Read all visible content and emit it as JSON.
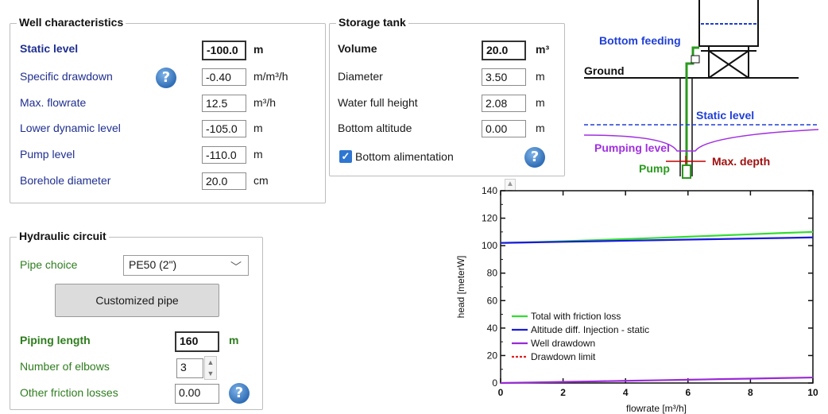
{
  "well": {
    "title": "Well characteristics",
    "static_level": {
      "label": "Static level",
      "value": "-100.0",
      "unit": "m"
    },
    "specific_drawdown": {
      "label": "Specific drawdown",
      "value": "-0.40",
      "unit": "m/m³/h"
    },
    "max_flowrate": {
      "label": "Max. flowrate",
      "value": "12.5",
      "unit": "m³/h"
    },
    "lower_dynamic_level": {
      "label": "Lower dynamic level",
      "value": "-105.0",
      "unit": "m"
    },
    "pump_level": {
      "label": "Pump level",
      "value": "-110.0",
      "unit": "m"
    },
    "borehole_diameter": {
      "label": "Borehole diameter",
      "value": "20.0",
      "unit": "cm"
    },
    "help_icon": "question-icon"
  },
  "tank": {
    "title": "Storage tank",
    "volume": {
      "label": "Volume",
      "value": "20.0",
      "unit": "m³"
    },
    "diameter": {
      "label": "Diameter",
      "value": "3.50",
      "unit": "m"
    },
    "water_full_height": {
      "label": "Water full height",
      "value": "2.08",
      "unit": "m"
    },
    "bottom_altitude": {
      "label": "Bottom altitude",
      "value": "0.00",
      "unit": "m"
    },
    "bottom_alimentation": {
      "label": "Bottom alimentation",
      "checked": true
    },
    "help_icon": "question-icon"
  },
  "hydraulic": {
    "title": "Hydraulic circuit",
    "pipe_choice": {
      "label": "Pipe choice",
      "value": "PE50 (2\")"
    },
    "customized_pipe_label": "Customized pipe",
    "piping_length": {
      "label": "Piping length",
      "value": "160",
      "unit": "m"
    },
    "number_of_elbows": {
      "label": "Number of elbows",
      "value": "3"
    },
    "other_friction_losses": {
      "label": "Other friction losses",
      "value": "0.00"
    },
    "help_icon": "question-icon"
  },
  "diagram": {
    "bottom_feeding": "Bottom feeding",
    "ground": "Ground",
    "static_level": "Static level",
    "pumping_level": "Pumping level",
    "pump": "Pump",
    "max_depth": "Max. depth",
    "colors": {
      "blue": "#1f3fd6",
      "purple": "#a030e0",
      "green": "#2a9a1e",
      "red": "#c00000"
    }
  },
  "chart_data": {
    "type": "line",
    "xlabel": "flowrate [m³/h]",
    "ylabel": "head [meterW]",
    "xlim": [
      0,
      10
    ],
    "ylim": [
      0,
      140
    ],
    "xticks": [
      "0",
      "2",
      "4",
      "6",
      "8",
      "10"
    ],
    "yticks": [
      "0",
      "20",
      "40",
      "60",
      "80",
      "100",
      "120",
      "140"
    ],
    "series": [
      {
        "name": "Total with friction loss",
        "color": "#33dd33",
        "x": [
          0,
          1,
          2,
          3,
          4,
          5,
          6,
          7,
          8,
          9,
          10
        ],
        "y": [
          102,
          102.5,
          103.2,
          104,
          104.8,
          105.6,
          106.5,
          107.4,
          108.3,
          109.2,
          110
        ]
      },
      {
        "name": "Altitude diff. Injection - static",
        "color": "#1a1adb",
        "x": [
          0,
          1,
          2,
          3,
          4,
          5,
          6,
          7,
          8,
          9,
          10
        ],
        "y": [
          102,
          102.4,
          102.8,
          103.2,
          103.6,
          104,
          104.4,
          104.8,
          105.2,
          105.6,
          106
        ]
      },
      {
        "name": "Well drawdown",
        "color": "#9a2ad8",
        "x": [
          0,
          1,
          2,
          3,
          4,
          5,
          6,
          7,
          8,
          9,
          10
        ],
        "y": [
          0,
          0.4,
          0.8,
          1.2,
          1.6,
          2,
          2.4,
          2.8,
          3.2,
          3.6,
          4
        ]
      },
      {
        "name": "Drawdown limit",
        "color": "#e02020",
        "dashed": true,
        "x": [],
        "y": []
      }
    ],
    "legend": "bottom-left",
    "grid": false
  }
}
